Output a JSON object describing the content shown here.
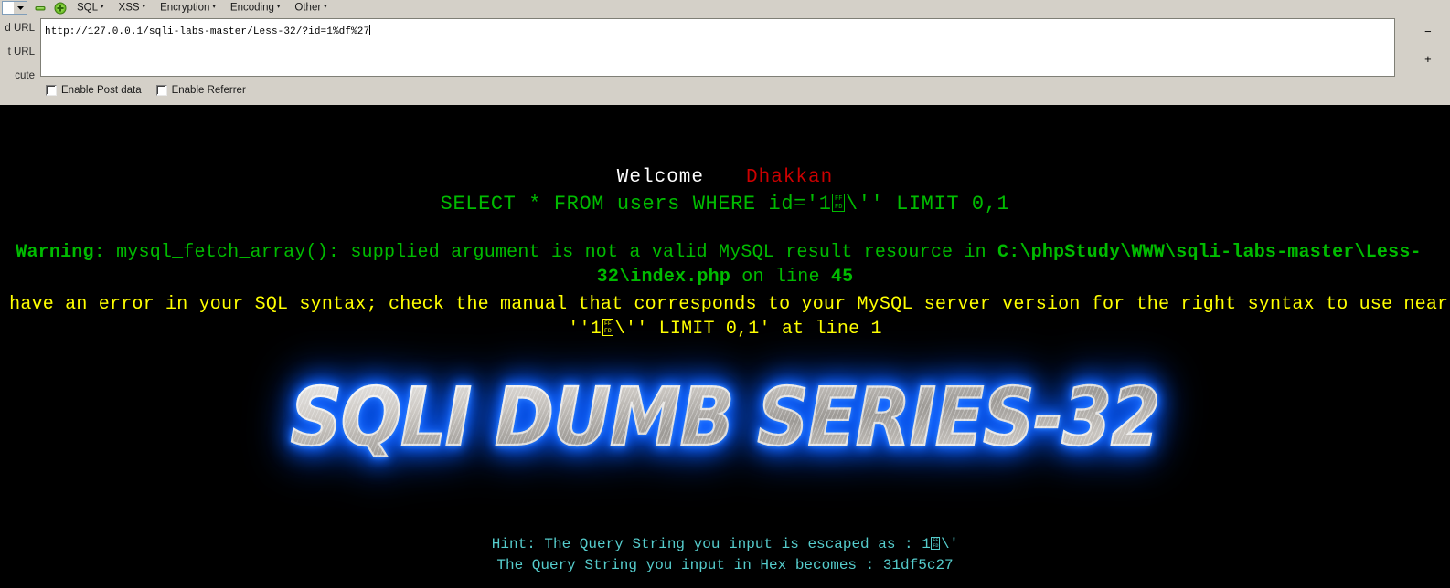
{
  "hackbar": {
    "menu_items": [
      {
        "label": "SQL",
        "name": "menu-sql"
      },
      {
        "label": "XSS",
        "name": "menu-xss"
      },
      {
        "label": "Encryption",
        "name": "menu-encryption"
      },
      {
        "label": "Encoding",
        "name": "menu-encoding"
      },
      {
        "label": "Other",
        "name": "menu-other"
      }
    ],
    "caret": "▾",
    "side_labels": [
      "d URL",
      "t URL",
      "cute"
    ],
    "url_value": "http://127.0.0.1/sqli-labs-master/Less-32/?id=1%df%27",
    "url_placeholder": "http://",
    "side_buttons": [
      "−",
      "+"
    ],
    "checkboxes": [
      {
        "label": "Enable Post data",
        "checked": false,
        "name": "enable-post-data"
      },
      {
        "label": "Enable Referrer",
        "checked": false,
        "name": "enable-referrer"
      }
    ]
  },
  "page": {
    "welcome": "Welcome",
    "user": "Dhakkan",
    "sql_query_pre": "SELECT * FROM users WHERE id='1",
    "sql_query_post": "\\'' LIMIT 0,1",
    "warning_label": "Warning",
    "warning_line1_a": ": mysql_fetch_array(): supplied argument is not a valid MySQL result resource in ",
    "warning_path": "C:\\phpStudy\\WWW\\sqli-labs-master\\Less-",
    "warning_line2_a": "32\\index.php",
    "warning_line2_b": " on line ",
    "warning_line_no": "45",
    "error_line1": "u have an error in your SQL syntax; check the manual that corresponds to your MySQL server version for the right syntax to use near",
    "error_line2_pre": "''1",
    "error_line2_post": "\\'' LIMIT 0,1' at line 1",
    "big_title": "SQLI DUMB SERIES-32",
    "hint_line1_pre": "Hint: The Query String you input is escaped as : 1",
    "hint_line1_post": "\\'",
    "hint_line2": "The Query String you input in Hex becomes : 31df5c27",
    "fffd_hi": "FF",
    "fffd_lo": "FD"
  },
  "colors": {
    "chrome": "#d4d0c8",
    "page_bg": "#000000",
    "sql_green": "#00bb00",
    "error_yellow": "#ffff00",
    "user_red": "#cc0000",
    "hint_cyan": "#55cccc",
    "title_glow": "#0a5cff"
  }
}
